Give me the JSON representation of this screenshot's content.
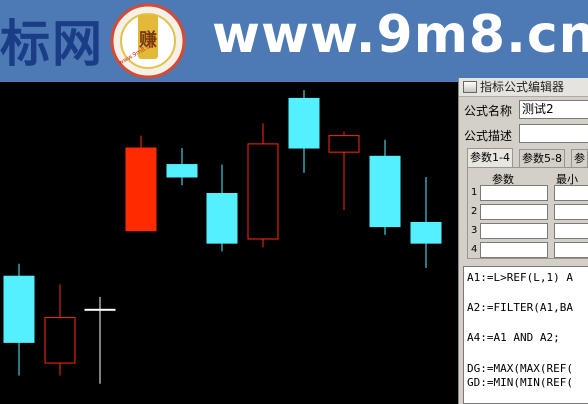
{
  "banner": {
    "left_text": "标网",
    "url_text": "www.9m8.cn",
    "logo_text": "赚",
    "logo_ring_text": "www.9m8.cn"
  },
  "chart": {
    "background": "#000000",
    "rise_color": "#ff2a00",
    "fall_color": "#55f0ff",
    "doji_color": "#ffffff",
    "candles": [
      {
        "open": 58,
        "close": 42,
        "high": 61,
        "low": 34,
        "type": "fall"
      },
      {
        "open": 37,
        "close": 48,
        "high": 56,
        "low": 34,
        "type": "rise"
      },
      {
        "open": 50,
        "close": 50,
        "high": 53,
        "low": 32,
        "type": "doji"
      },
      {
        "open": 69,
        "close": 89,
        "high": 92,
        "low": 71,
        "type": "rise",
        "filled": true
      },
      {
        "open": 85,
        "close": 82,
        "high": 89,
        "low": 80,
        "type": "fall"
      },
      {
        "open": 78,
        "close": 66,
        "high": 85,
        "low": 64,
        "type": "fall"
      },
      {
        "open": 67,
        "close": 90,
        "high": 95,
        "low": 65,
        "type": "rise"
      },
      {
        "open": 101,
        "close": 89,
        "high": 103,
        "low": 83,
        "type": "fall"
      },
      {
        "open": 88,
        "close": 92,
        "high": 93,
        "low": 74,
        "type": "rise"
      },
      {
        "open": 87,
        "close": 70,
        "high": 91,
        "low": 68,
        "type": "fall"
      },
      {
        "open": 71,
        "close": 66,
        "high": 82,
        "low": 60,
        "type": "fall"
      }
    ]
  },
  "editor": {
    "title": "指标公式编辑器",
    "name_label": "公式名称",
    "name_value": "测试2",
    "desc_label": "公式描述",
    "desc_value": "",
    "tabs": [
      "参数1-4",
      "参数5-8",
      "参"
    ],
    "param_header_1": "参数",
    "param_header_2": "最小",
    "rows": [
      "1",
      "2",
      "3",
      "4"
    ],
    "code_lines": [
      "A1:=L>REF(L,1) A",
      "A2:=FILTER(A1,BA",
      "A4:=A1 AND A2;",
      "DG:=MAX(MAX(REF(",
      "GD:=MIN(MIN(REF("
    ]
  }
}
